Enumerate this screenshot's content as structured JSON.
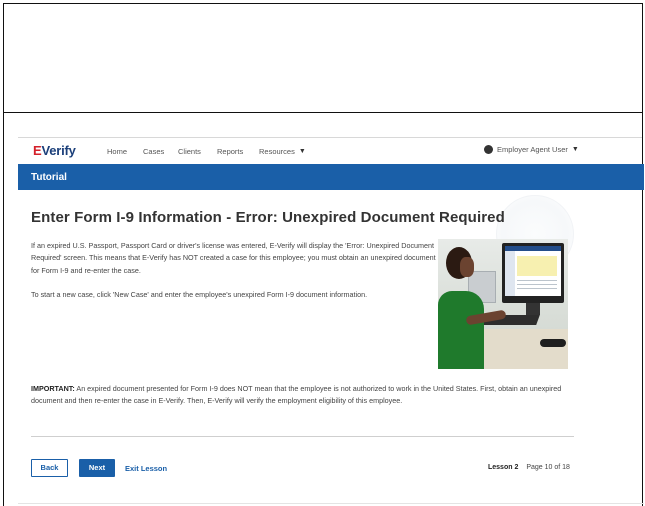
{
  "nav": {
    "logo_prefix": "E",
    "logo_text": "Verify",
    "links": [
      "Home",
      "Cases",
      "Clients",
      "Reports",
      "Resources"
    ],
    "user_label": "Employer Agent User"
  },
  "tutorial_bar": {
    "label": "Tutorial"
  },
  "content": {
    "heading": "Enter Form I-9 Information - Error: Unexpired Document Required",
    "paragraph1": "If an expired U.S. Passport, Passport Card or driver's license was entered, E-Verify will display the 'Error: Unexpired Document Required' screen. This means that E-Verify has NOT created a case for this employee; you must obtain an unexpired document for Form I-9 and re-enter the case.",
    "paragraph2": "To start a new case, click 'New Case' and enter the employee's unexpired Form I-9 document information.",
    "important_label": "IMPORTANT:",
    "important_text": " An expired document presented for Form I-9 does NOT mean that the employee is not authorized to work in the United States. First, obtain an unexpired document and then re-enter the case in E-Verify. Then, E-Verify will verify the employment eligibility of this employee."
  },
  "footer": {
    "back_label": "Back",
    "next_label": "Next",
    "exit_label": "Exit Lesson",
    "lesson_label": "Lesson 2",
    "page_label": "Page 10 of 18"
  },
  "colors": {
    "primary": "#1a5fa8",
    "logo_red": "#d4202a",
    "logo_navy": "#1b3f7a"
  }
}
